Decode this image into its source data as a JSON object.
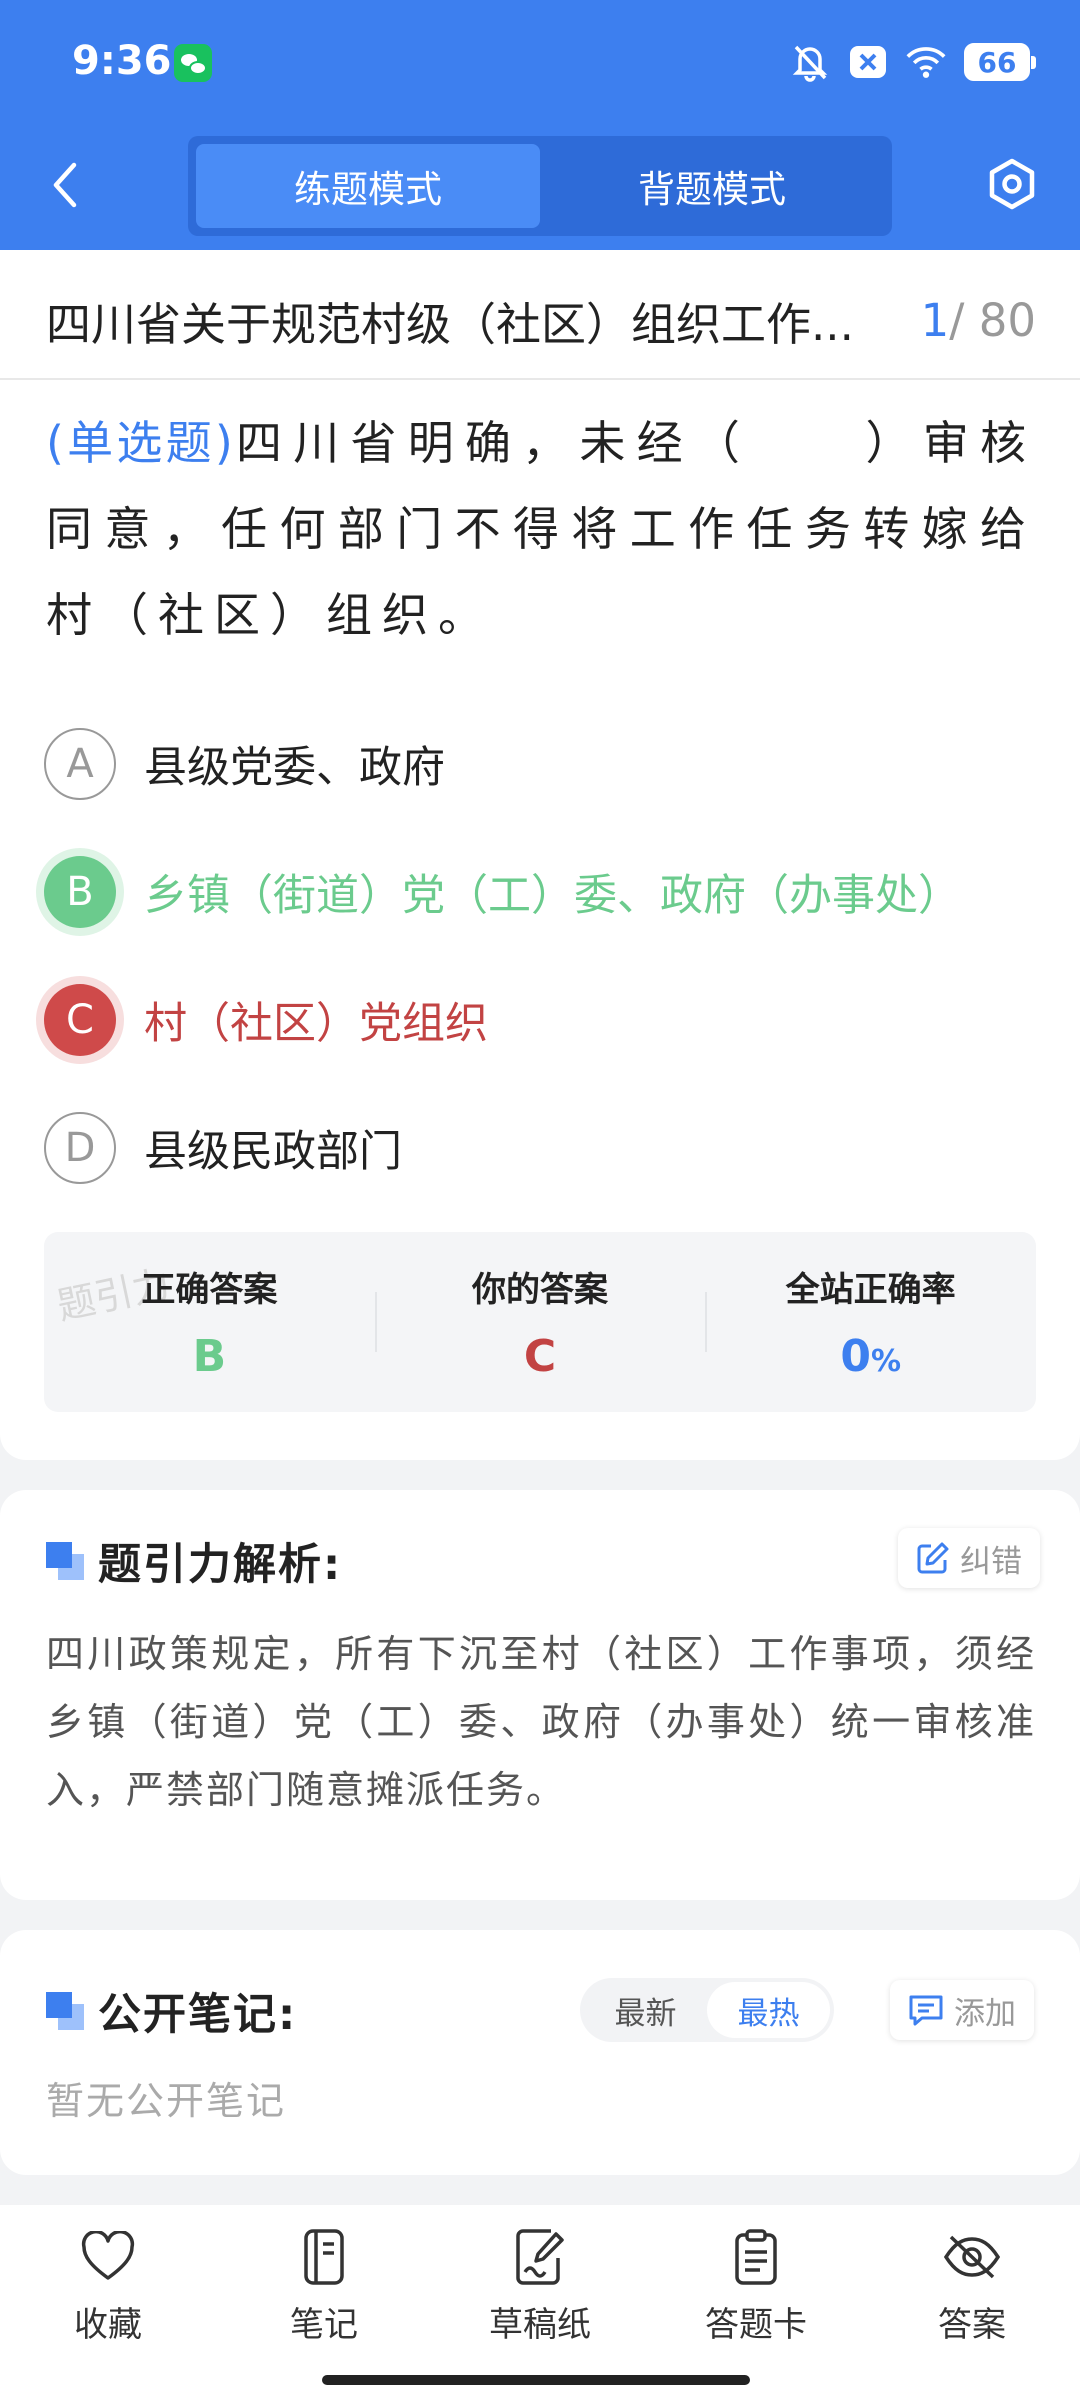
{
  "status_bar": {
    "time": "9:36",
    "battery": "66"
  },
  "header": {
    "tabs": [
      {
        "label": "练题模式",
        "active": true
      },
      {
        "label": "背题模式",
        "active": false
      }
    ]
  },
  "question": {
    "paper_title": "四川省关于规范村级（社区）组织工作...",
    "current": "1",
    "total": "/ 80",
    "type_label": "(单选题)",
    "stem": "四川省明确，未经（　　）审核同意，任何部门不得将工作任务转嫁给村（社区）组织。",
    "options": [
      {
        "letter": "A",
        "text": "县级党委、政府",
        "state": "normal"
      },
      {
        "letter": "B",
        "text": "乡镇（街道）党（工）委、政府（办事处）",
        "state": "correct"
      },
      {
        "letter": "C",
        "text": "村（社区）党组织",
        "state": "wrong"
      },
      {
        "letter": "D",
        "text": "县级民政部门",
        "state": "normal"
      }
    ]
  },
  "result": {
    "watermark": "题引力",
    "correct_label": "正确答案",
    "correct_value": "B",
    "yours_label": "你的答案",
    "yours_value": "C",
    "rate_label": "全站正确率",
    "rate_value": "0",
    "rate_unit": "%"
  },
  "analysis": {
    "title": "题引力解析:",
    "report_label": "纠错",
    "text": "四川政策规定，所有下沉至村（社区）工作事项，须经乡镇（街道）党（工）委、政府（办事处）统一审核准入，严禁部门随意摊派任务。"
  },
  "notes": {
    "title": "公开笔记:",
    "sort_latest": "最新",
    "sort_hot": "最热",
    "add_label": "添加",
    "empty": "暂无公开笔记"
  },
  "bottom_tabs": [
    {
      "label": "收藏",
      "icon": "heart-icon"
    },
    {
      "label": "笔记",
      "icon": "notebook-icon"
    },
    {
      "label": "草稿纸",
      "icon": "draft-icon"
    },
    {
      "label": "答题卡",
      "icon": "answer-card-icon"
    },
    {
      "label": "答案",
      "icon": "eye-off-icon"
    }
  ],
  "colors": {
    "primary": "#3d7fef",
    "correct": "#6bcb8d",
    "wrong": "#cf4a4a"
  }
}
